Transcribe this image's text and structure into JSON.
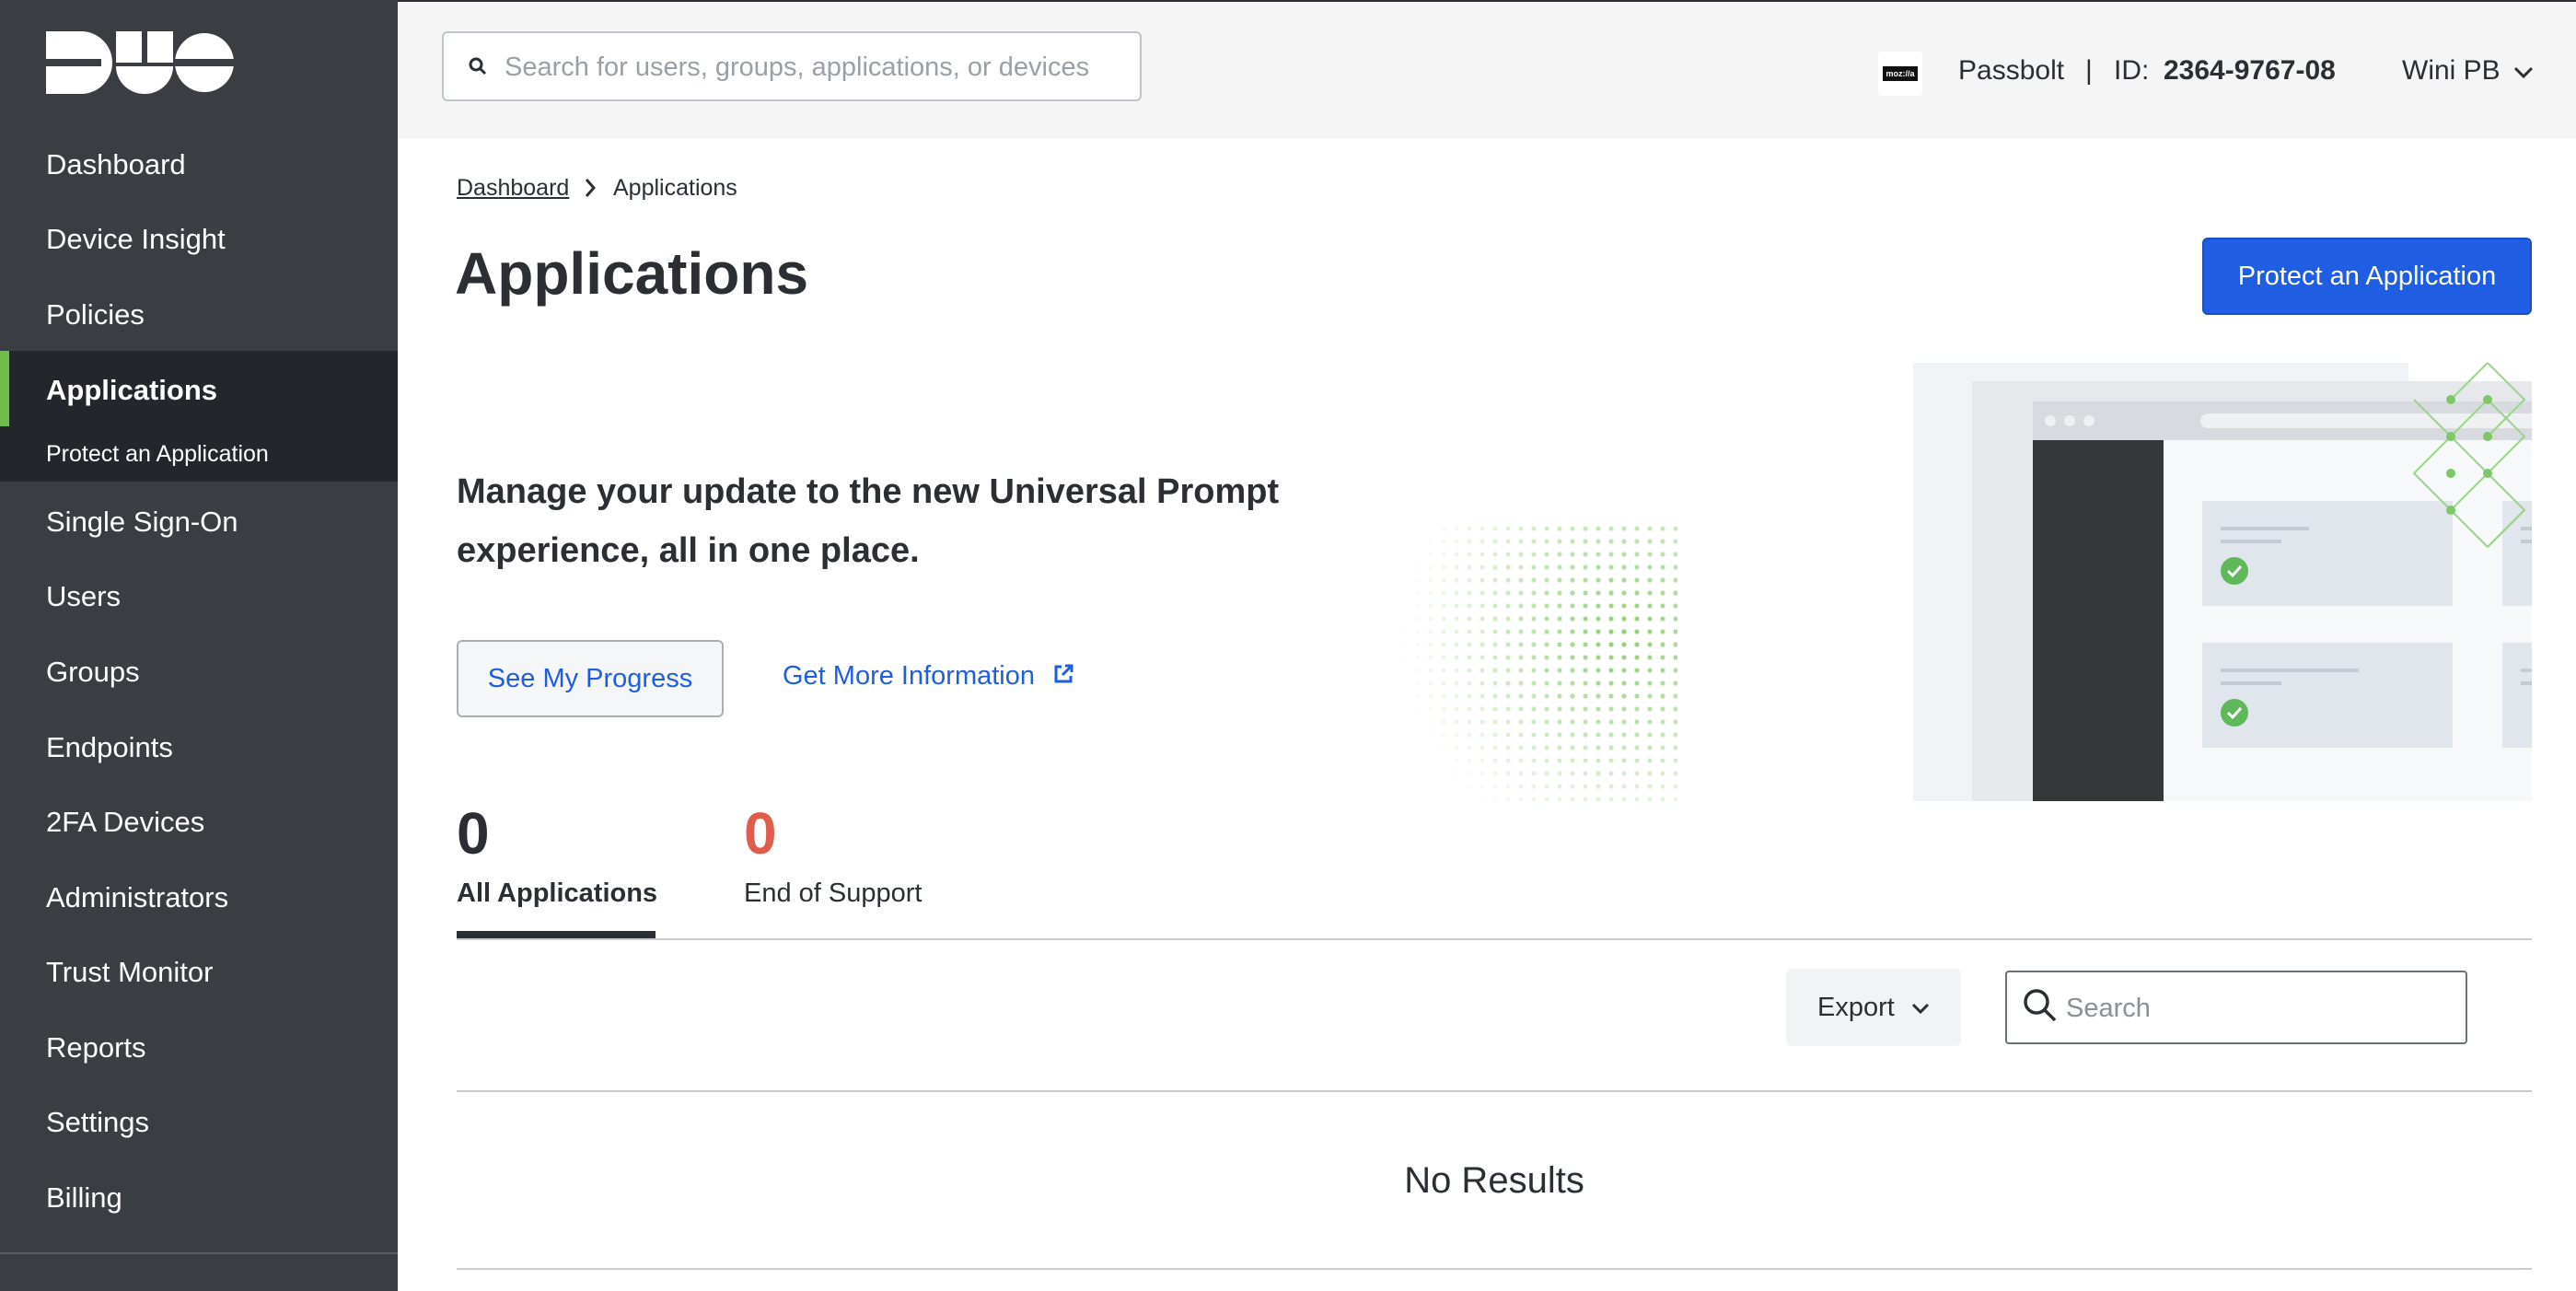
{
  "app": {
    "brand": "DUO"
  },
  "sidebar": {
    "items": [
      {
        "label": "Dashboard"
      },
      {
        "label": "Device Insight"
      },
      {
        "label": "Policies"
      },
      {
        "label": "Applications"
      },
      {
        "label": "Protect an Application"
      },
      {
        "label": "Single Sign-On"
      },
      {
        "label": "Users"
      },
      {
        "label": "Groups"
      },
      {
        "label": "Endpoints"
      },
      {
        "label": "2FA Devices"
      },
      {
        "label": "Administrators"
      },
      {
        "label": "Trust Monitor"
      },
      {
        "label": "Reports"
      },
      {
        "label": "Settings"
      },
      {
        "label": "Billing"
      }
    ],
    "active_item": "Applications"
  },
  "header": {
    "search_placeholder": "Search for users, groups, applications, or devices",
    "org_logo_text": "moz://a",
    "org_name": "Passbolt",
    "separator": "|",
    "id_label": "ID:",
    "id_value": "2364-9767-08",
    "user_name": "Wini PB"
  },
  "breadcrumb": {
    "parent": "Dashboard",
    "current": "Applications"
  },
  "page": {
    "title": "Applications",
    "primary_button": "Protect an Application"
  },
  "promo": {
    "text": "Manage your update to the new Universal Prompt experience, all in one place.",
    "progress_button": "See My Progress",
    "info_link": "Get More Information"
  },
  "tabs": [
    {
      "count": "0",
      "label": "All Applications"
    },
    {
      "count": "0",
      "label": "End of Support"
    }
  ],
  "toolbar": {
    "export_label": "Export",
    "search_placeholder": "Search"
  },
  "table": {
    "empty_message": "No Results"
  },
  "colors": {
    "sidebar_bg": "#3a3e43",
    "active_indicator": "#6dbd4a",
    "primary": "#1f5ee3",
    "end_of_support": "#e05c4b"
  }
}
